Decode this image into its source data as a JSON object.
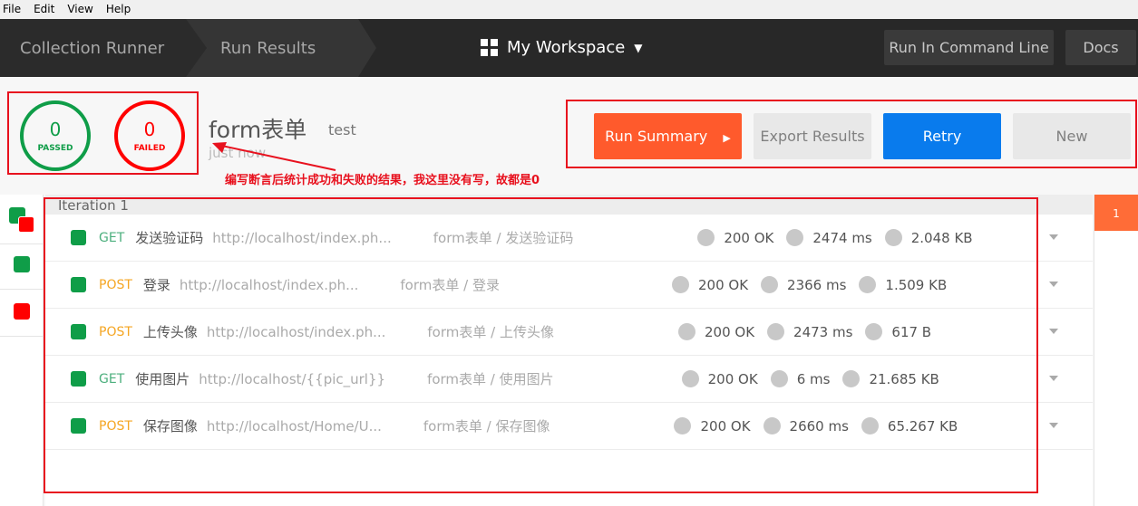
{
  "menu": [
    "File",
    "Edit",
    "View",
    "Help"
  ],
  "header": {
    "crumbs": [
      "Collection Runner",
      "Run Results"
    ],
    "workspace": "My Workspace",
    "run_cmd": "Run In Command Line",
    "docs": "Docs"
  },
  "summary": {
    "passed": "0",
    "passed_label": "PASSED",
    "failed": "0",
    "failed_label": "FAILED",
    "title": "form表单",
    "env": "test",
    "time": "just now"
  },
  "actions": {
    "run_summary": "Run Summary",
    "export": "Export Results",
    "retry": "Retry",
    "new": "New"
  },
  "annotation": "编写断言后统计成功和失败的结果，我这里没有写，故都是0",
  "iteration": "Iteration 1",
  "right_tab": "1",
  "colors": {
    "get": "#4caf7d",
    "post": "#f5a623",
    "pass": "#0f9d48",
    "fail": "#ff0000",
    "accent": "#ff6c37",
    "retry": "#097bed"
  },
  "requests": [
    {
      "method": "GET",
      "name": "发送验证码",
      "url": "http://localhost/index.ph...",
      "path": "form表单 / 发送验证码",
      "status": "200 OK",
      "time": "2474 ms",
      "size": "2.048 KB"
    },
    {
      "method": "POST",
      "name": "登录",
      "url": "http://localhost/index.ph...",
      "path": "form表单 / 登录",
      "status": "200 OK",
      "time": "2366 ms",
      "size": "1.509 KB"
    },
    {
      "method": "POST",
      "name": "上传头像",
      "url": "http://localhost/index.ph...",
      "path": "form表单 / 上传头像",
      "status": "200 OK",
      "time": "2473 ms",
      "size": "617 B"
    },
    {
      "method": "GET",
      "name": "使用图片",
      "url": "http://localhost/{{pic_url}}",
      "path": "form表单 / 使用图片",
      "status": "200 OK",
      "time": "6 ms",
      "size": "21.685 KB"
    },
    {
      "method": "POST",
      "name": "保存图像",
      "url": "http://localhost/Home/U...",
      "path": "form表单 / 保存图像",
      "status": "200 OK",
      "time": "2660 ms",
      "size": "65.267 KB"
    }
  ]
}
